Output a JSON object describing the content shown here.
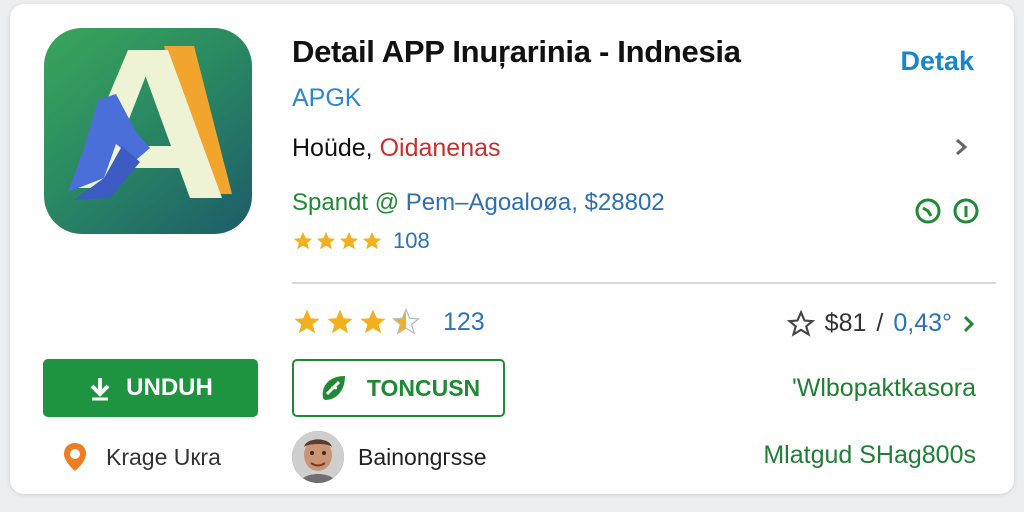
{
  "app": {
    "title": "Detail APP Inuŗarinia - Indnesia",
    "developer": "APGK",
    "category_main": "Hoüde,",
    "category_sub": "Oidanenas",
    "info_green": "Spandt @",
    "info_blue": "Pem–Agoaloøa, $28802",
    "small_rating_count": "108"
  },
  "header": {
    "detail_link": "Detak"
  },
  "rating": {
    "value": 3.5,
    "max": 5,
    "count": "123"
  },
  "price": {
    "price_a": "$81",
    "separator": "/",
    "price_b": "0,43°"
  },
  "buttons": {
    "download_label": "UNDUH",
    "secondary_label": "TONCUSN"
  },
  "links": {
    "website": "'Wlbopaktkasora",
    "footer": "Mlatgud SHag800s"
  },
  "location": {
    "label": "Krage Uкra"
  },
  "user": {
    "name": "Bainongгsse"
  },
  "icons": {
    "app_icon": "app-logo-a",
    "download": "download-arrow-icon",
    "secondary": "refresh-leaf-icon",
    "location": "location-pin-icon",
    "star_outline": "star-outline-icon",
    "chevron": "chevron-right-icon"
  },
  "colors": {
    "primary_green": "#1f9440",
    "link_blue": "#1a86c9",
    "star_gold": "#f2b01e",
    "accent_red": "#c9302c"
  }
}
